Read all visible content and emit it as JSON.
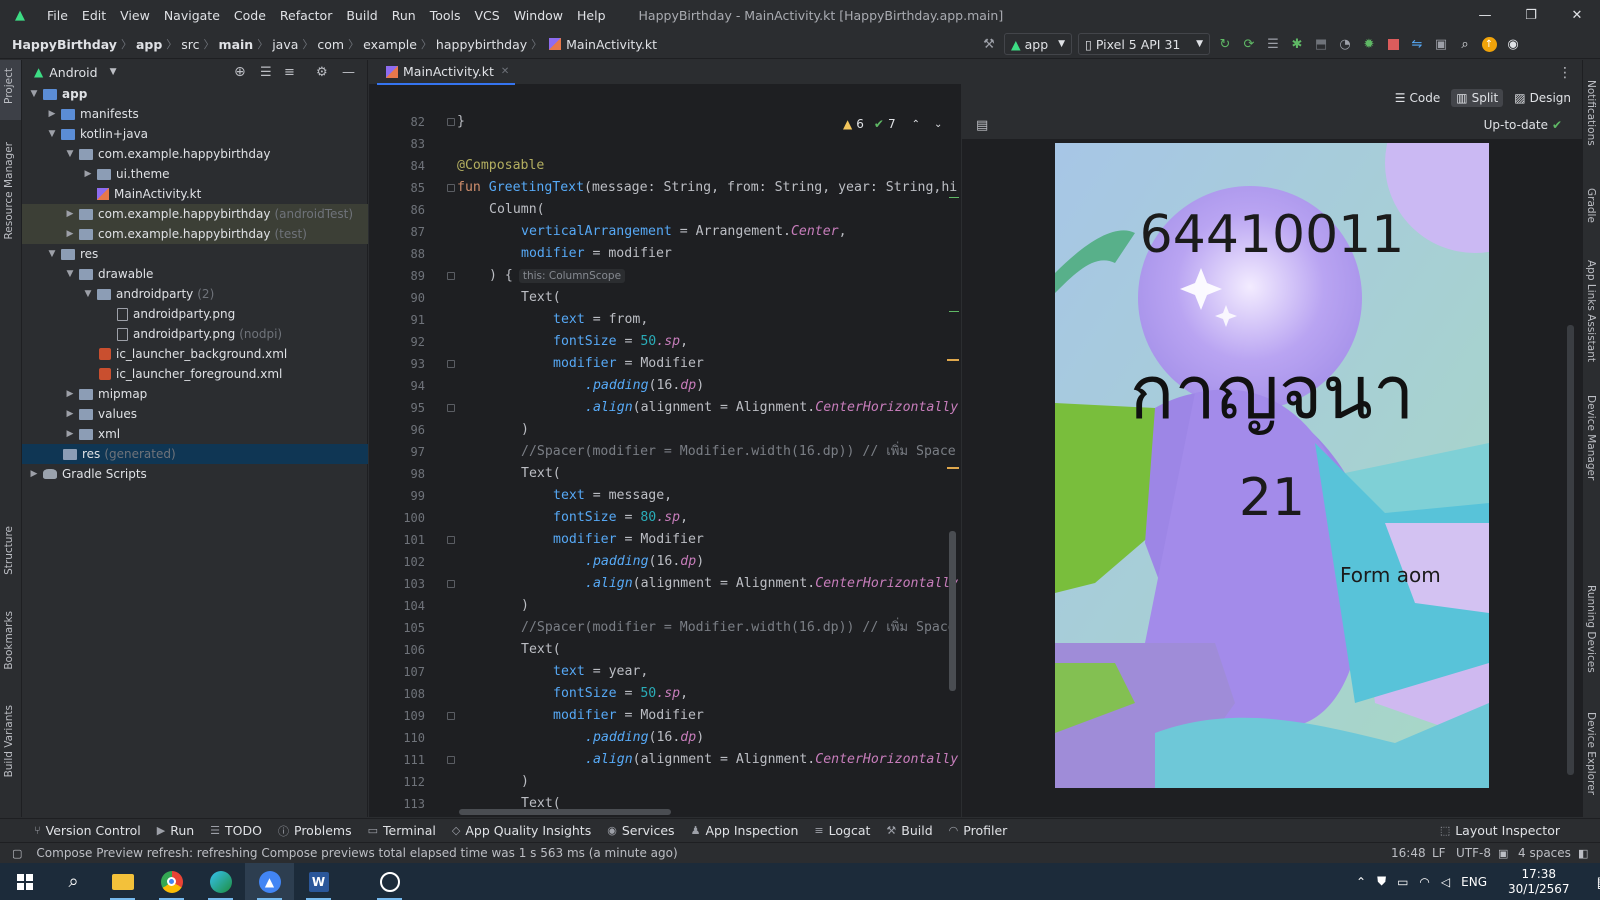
{
  "menubar": {
    "items": [
      "File",
      "Edit",
      "View",
      "Navigate",
      "Code",
      "Refactor",
      "Build",
      "Run",
      "Tools",
      "VCS",
      "Window",
      "Help"
    ],
    "window_title": "HappyBirthday - MainActivity.kt [HappyBirthday.app.main]"
  },
  "breadcrumb": [
    "HappyBirthday",
    "app",
    "src",
    "main",
    "java",
    "com",
    "example",
    "happybirthday",
    "MainActivity.kt"
  ],
  "toolbar": {
    "run_config": "app",
    "device": "Pixel 5 API 31"
  },
  "left_strip": [
    "Project",
    "Resource Manager",
    "Structure",
    "Bookmarks",
    "Build Variants"
  ],
  "project": {
    "view_mode": "Android",
    "tree": [
      {
        "label": "app",
        "extra": ""
      },
      {
        "label": "manifests",
        "extra": ""
      },
      {
        "label": "kotlin+java",
        "extra": ""
      },
      {
        "label": "com.example.happybirthday",
        "extra": ""
      },
      {
        "label": "ui.theme",
        "extra": ""
      },
      {
        "label": "MainActivity.kt",
        "extra": ""
      },
      {
        "label": "com.example.happybirthday",
        "extra": "(androidTest)"
      },
      {
        "label": "com.example.happybirthday",
        "extra": "(test)"
      },
      {
        "label": "res",
        "extra": ""
      },
      {
        "label": "drawable",
        "extra": ""
      },
      {
        "label": "androidparty",
        "extra": "(2)"
      },
      {
        "label": "androidparty.png",
        "extra": ""
      },
      {
        "label": "androidparty.png",
        "extra": "(nodpi)"
      },
      {
        "label": "ic_launcher_background.xml",
        "extra": ""
      },
      {
        "label": "ic_launcher_foreground.xml",
        "extra": ""
      },
      {
        "label": "mipmap",
        "extra": ""
      },
      {
        "label": "values",
        "extra": ""
      },
      {
        "label": "xml",
        "extra": ""
      },
      {
        "label": "res",
        "extra": "(generated)"
      },
      {
        "label": "Gradle Scripts",
        "extra": ""
      }
    ]
  },
  "editor": {
    "tab_label": "MainActivity.kt",
    "warnings": "6",
    "weak_warnings": "7",
    "inlay_hint": "this: ColumnScope",
    "line_numbers": [
      "82",
      "83",
      "84",
      "85",
      "86",
      "87",
      "88",
      "89",
      "90",
      "91",
      "92",
      "93",
      "94",
      "95",
      "96",
      "97",
      "98",
      "99",
      "100",
      "101",
      "102",
      "103",
      "104",
      "105",
      "106",
      "107",
      "108",
      "109",
      "110",
      "111",
      "112",
      "113"
    ],
    "text": {
      "composable": "@Composable",
      "fun_kw": "fun ",
      "fun_name": "GreetingText",
      "sig": "(message: String, from: String, year: String,hi",
      "column": "Column(",
      "va_key": "verticalArrangement",
      "va_val": " = Arrangement.",
      "center": "Center",
      "comma": ",",
      "modifier_key": "modifier",
      "modifier_val": " = modifier",
      "close_brace": ") {",
      "brace": "}",
      "text_open": "Text(",
      "text_key": "text",
      "from_val": " = from,",
      "message_val": " = message,",
      "year_val": " = year,",
      "fontsize_key": "fontSize",
      "fs50": "50",
      "fs80": "80",
      "sp": ".sp",
      "modifier_assign": " = Modifier",
      "padding": ".padding",
      "pad_arg": "(16.",
      "dp": "dp",
      "pad_close": ")",
      "align": ".align",
      "align_arg": "(alignment = Alignment.",
      "center_h": "CenterHorizontally",
      "close_paren": ")",
      "spacer_comment": "//Spacer(modifier = Modifier.width(16.dp)) // เพิ่ม Space"
    }
  },
  "preview": {
    "modes": [
      "Code",
      "Split",
      "Design"
    ],
    "status": "Up-to-date",
    "card": {
      "number": "64410011",
      "name": "กาญจนา",
      "age": "21",
      "from": "Form aom"
    }
  },
  "right_strip": [
    "Notifications",
    "Gradle",
    "App Links Assistant",
    "Device Manager",
    "Running Devices",
    "Device Explorer"
  ],
  "tool_windows": [
    "Version Control",
    "Run",
    "TODO",
    "Problems",
    "Terminal",
    "App Quality Insights",
    "Services",
    "App Inspection",
    "Logcat",
    "Build",
    "Profiler"
  ],
  "layout_inspector": "Layout Inspector",
  "statusbar": {
    "message": "Compose Preview refresh: refreshing Compose previews total elapsed time was 1 s 563 ms (a minute ago)",
    "position": "16:48",
    "line_sep": "LF",
    "encoding": "UTF-8",
    "indent": "4 spaces"
  },
  "taskbar": {
    "lang": "ENG",
    "time": "17:38",
    "date": "30/1/2567",
    "notif_count": "1"
  }
}
